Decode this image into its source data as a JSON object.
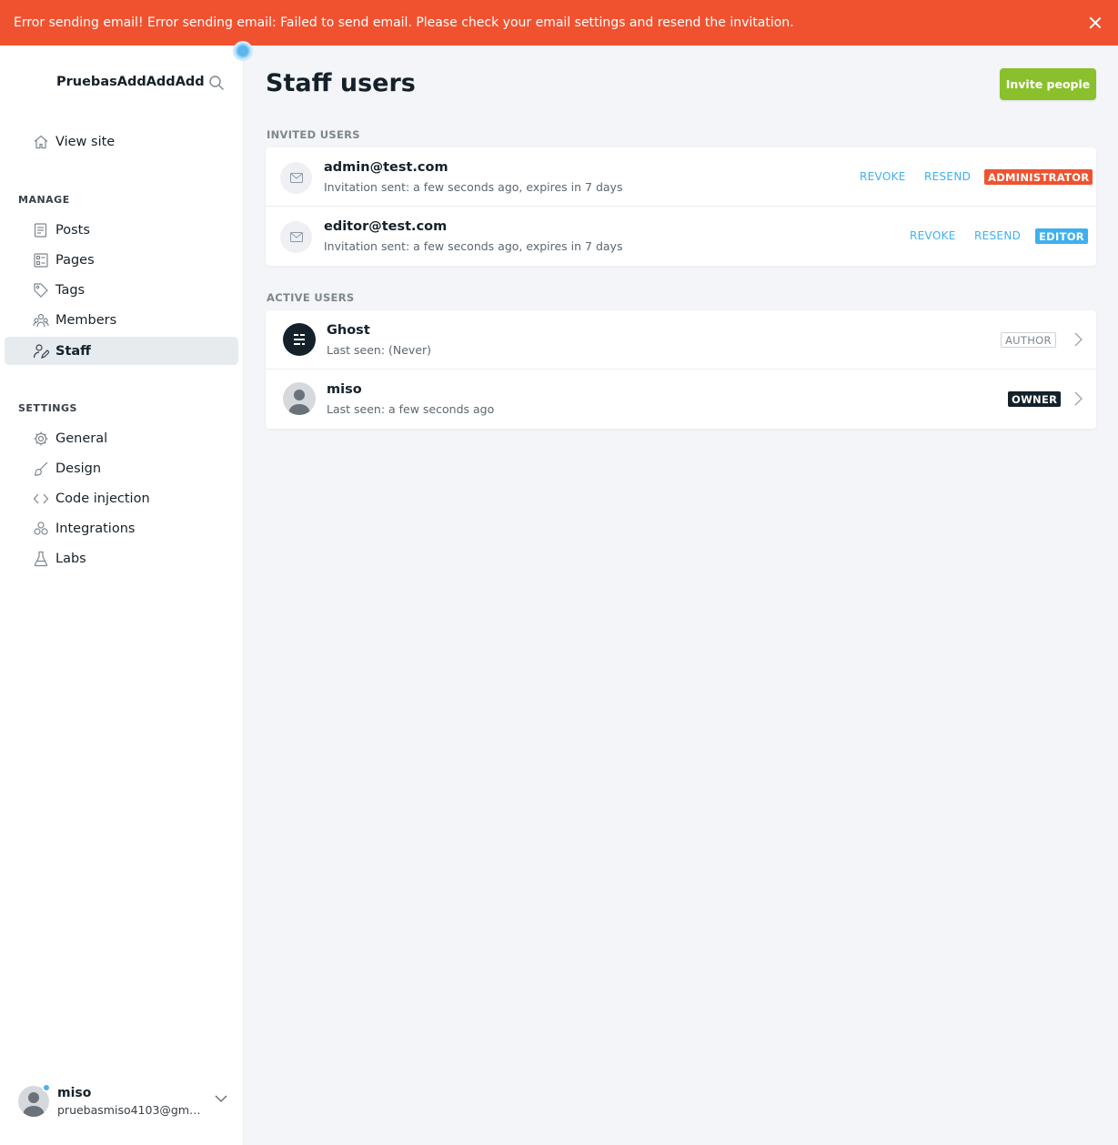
{
  "alert": {
    "message": "Error sending email! Error sending email: Failed to send email. Please check your email settings and resend the invitation."
  },
  "sidebar": {
    "brand": "PruebasAddAddAdd",
    "view_site": "View site",
    "manage_label": "MANAGE",
    "manage_items": [
      {
        "label": "Posts",
        "icon": "posts-icon"
      },
      {
        "label": "Pages",
        "icon": "pages-icon"
      },
      {
        "label": "Tags",
        "icon": "tag-icon"
      },
      {
        "label": "Members",
        "icon": "members-icon"
      },
      {
        "label": "Staff",
        "icon": "staff-icon",
        "active": true
      }
    ],
    "settings_label": "SETTINGS",
    "settings_items": [
      {
        "label": "General",
        "icon": "gear-icon"
      },
      {
        "label": "Design",
        "icon": "brush-icon"
      },
      {
        "label": "Code injection",
        "icon": "code-icon"
      },
      {
        "label": "Integrations",
        "icon": "integrations-icon"
      },
      {
        "label": "Labs",
        "icon": "flask-icon"
      }
    ],
    "user": {
      "name": "miso",
      "email": "pruebasmiso4103@gmai..."
    }
  },
  "main": {
    "title": "Staff users",
    "invite_button": "Invite people",
    "invited_label": "INVITED USERS",
    "invited": [
      {
        "email": "admin@test.com",
        "status": "Invitation sent: a few seconds ago, expires in 7 days",
        "revoke": "REVOKE",
        "resend": "RESEND",
        "role": "ADMINISTRATOR"
      },
      {
        "email": "editor@test.com",
        "status": "Invitation sent: a few seconds ago, expires in 7 days",
        "revoke": "REVOKE",
        "resend": "RESEND",
        "role": "EDITOR"
      }
    ],
    "active_label": "ACTIVE USERS",
    "active": [
      {
        "name": "Ghost",
        "last_seen": "Last seen: (Never)",
        "role": "AUTHOR"
      },
      {
        "name": "miso",
        "last_seen": "Last seen: a few seconds ago",
        "role": "OWNER"
      }
    ]
  },
  "colors": {
    "alert": "#f05230",
    "accent_green": "#8ac02c",
    "link_blue": "#3eb0ef",
    "admin_badge": "#f05230",
    "editor_badge": "#3eb0ef",
    "owner_badge": "#15212a"
  }
}
